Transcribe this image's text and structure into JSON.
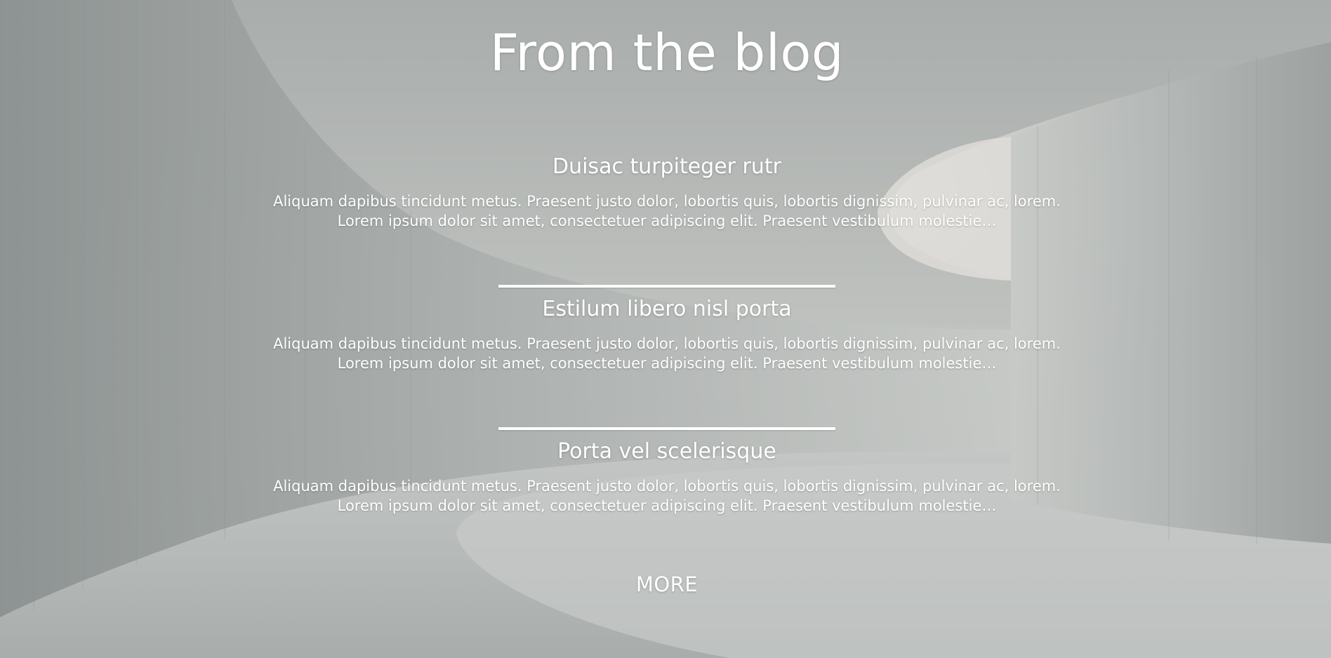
{
  "page_title": "From the blog",
  "posts": [
    {
      "title": "Duisac turpiteger rutr",
      "excerpt_line1": "Aliquam dapibus tincidunt metus. Praesent justo dolor, lobortis quis, lobortis dignissim, pulvinar ac, lorem.",
      "excerpt_line2": "Lorem ipsum dolor sit amet, consectetuer adipiscing elit. Praesent vestibulum molestie…"
    },
    {
      "title": "Estilum libero nisl porta",
      "excerpt_line1": "Aliquam dapibus tincidunt metus. Praesent justo dolor, lobortis quis, lobortis dignissim, pulvinar ac, lorem.",
      "excerpt_line2": "Lorem ipsum dolor sit amet, consectetuer adipiscing elit. Praesent vestibulum molestie…"
    },
    {
      "title": "Porta vel scelerisque",
      "excerpt_line1": "Aliquam dapibus tincidunt metus. Praesent justo dolor, lobortis quis, lobortis dignissim, pulvinar ac, lorem.",
      "excerpt_line2": "Lorem ipsum dolor sit amet, consectetuer adipiscing elit. Praesent vestibulum molestie…"
    }
  ],
  "more_label": "MORE",
  "colors": {
    "text": "#ffffff",
    "divider": "#ffffff",
    "background_concrete": "#b8bcba"
  }
}
